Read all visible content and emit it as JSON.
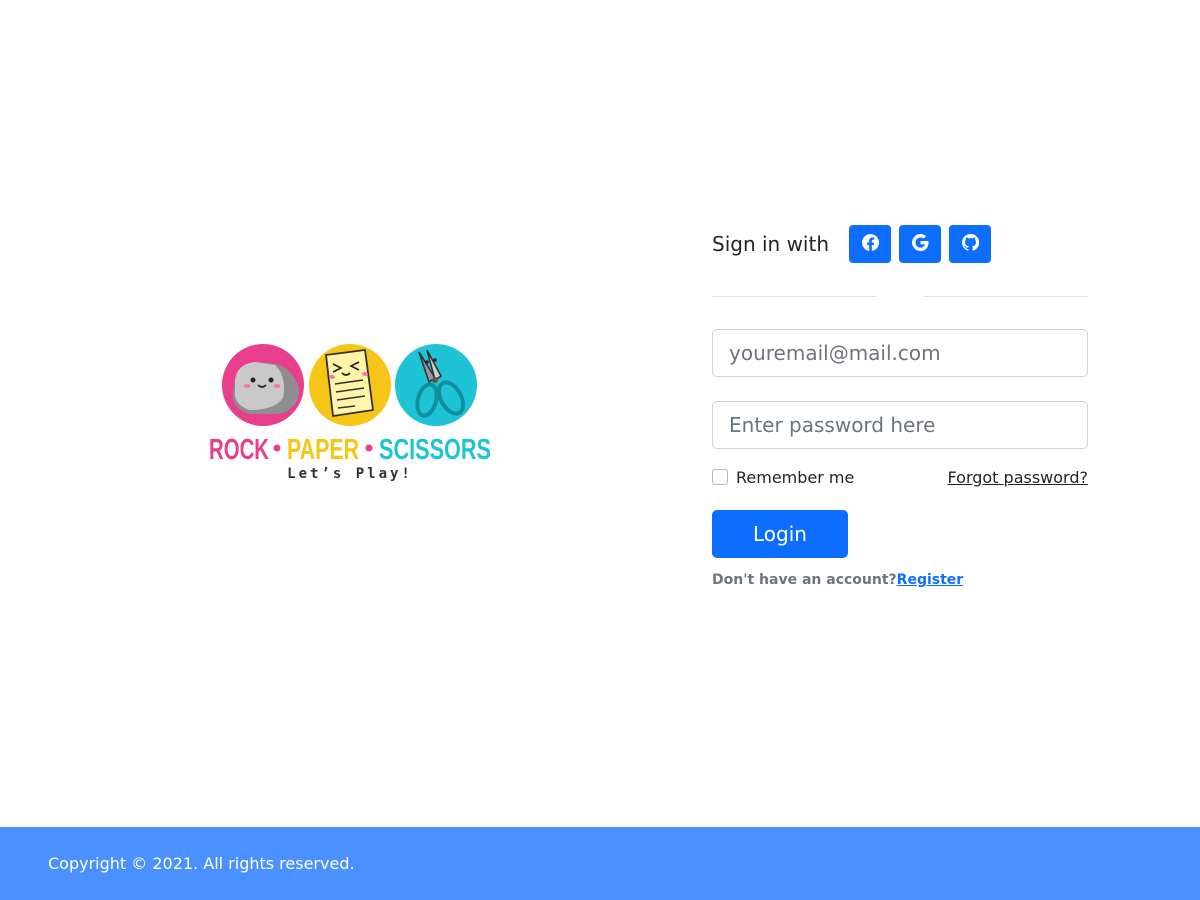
{
  "logo": {
    "words": [
      "ROCK",
      "PAPER",
      "SCISSORS"
    ],
    "tagline": "Let’s Play!",
    "colors": {
      "rock": "#e83e8c",
      "paper": "#f5c518",
      "scissors": "#1fc3d6"
    }
  },
  "signin": {
    "label": "Sign in with",
    "providers": [
      {
        "name": "Facebook",
        "icon": "facebook-icon"
      },
      {
        "name": "Google",
        "icon": "google-icon"
      },
      {
        "name": "GitHub",
        "icon": "github-icon"
      }
    ]
  },
  "form": {
    "email_placeholder": "youremail@mail.com",
    "password_placeholder": "Enter password here",
    "remember_label": "Remember me",
    "forgot_label": "Forgot password?",
    "login_label": "Login",
    "no_account_text": "Don't have an account?",
    "register_label": "Register"
  },
  "footer": {
    "copyright": "Copyright © 2021. All rights reserved."
  },
  "colors": {
    "primary": "#0d6efd",
    "footer_bg": "#4a90ff"
  }
}
